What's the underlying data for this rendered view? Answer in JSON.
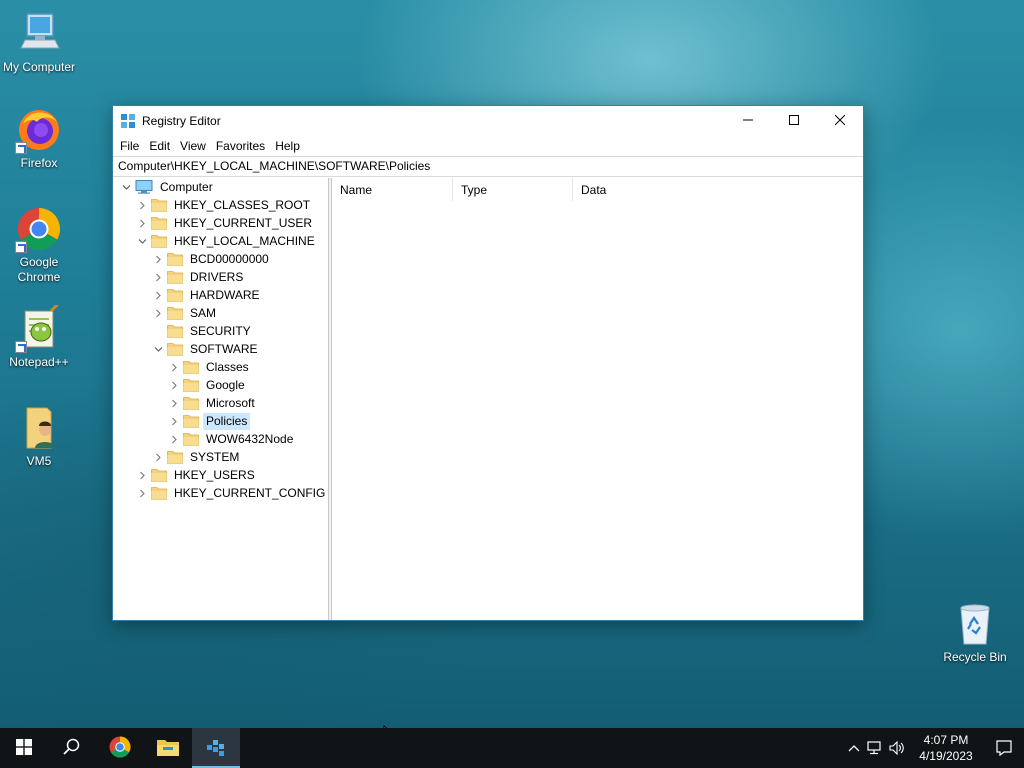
{
  "desktop": {
    "icons": [
      {
        "label": "My Computer",
        "icon": "monitor-icon"
      },
      {
        "label": "Firefox",
        "icon": "firefox-icon"
      },
      {
        "label": "Google Chrome",
        "icon": "chrome-icon"
      },
      {
        "label": "Notepad++",
        "icon": "notepadpp-icon"
      },
      {
        "label": "VM5",
        "icon": "user-folder-icon"
      },
      {
        "label": "Recycle Bin",
        "icon": "recycle-bin-icon"
      }
    ]
  },
  "window": {
    "title": "Registry Editor",
    "controls": {
      "minimize": "minimize",
      "maximize": "maximize",
      "close": "close"
    },
    "menu": [
      "File",
      "Edit",
      "View",
      "Favorites",
      "Help"
    ],
    "address": "Computer\\HKEY_LOCAL_MACHINE\\SOFTWARE\\Policies",
    "columns": [
      "Name",
      "Type",
      "Data"
    ],
    "tree": [
      {
        "label": "Computer",
        "level": 0,
        "chevron": "down",
        "icon": "computer"
      },
      {
        "label": "HKEY_CLASSES_ROOT",
        "level": 1,
        "chevron": "right"
      },
      {
        "label": "HKEY_CURRENT_USER",
        "level": 1,
        "chevron": "right"
      },
      {
        "label": "HKEY_LOCAL_MACHINE",
        "level": 1,
        "chevron": "down"
      },
      {
        "label": "BCD00000000",
        "level": 2,
        "chevron": "right"
      },
      {
        "label": "DRIVERS",
        "level": 2,
        "chevron": "right"
      },
      {
        "label": "HARDWARE",
        "level": 2,
        "chevron": "right"
      },
      {
        "label": "SAM",
        "level": 2,
        "chevron": "right"
      },
      {
        "label": "SECURITY",
        "level": 2,
        "chevron": "none"
      },
      {
        "label": "SOFTWARE",
        "level": 2,
        "chevron": "down"
      },
      {
        "label": "Classes",
        "level": 3,
        "chevron": "right"
      },
      {
        "label": "Google",
        "level": 3,
        "chevron": "right"
      },
      {
        "label": "Microsoft",
        "level": 3,
        "chevron": "right"
      },
      {
        "label": "Policies",
        "level": 3,
        "chevron": "right",
        "selected": true
      },
      {
        "label": "WOW6432Node",
        "level": 3,
        "chevron": "right"
      },
      {
        "label": "SYSTEM",
        "level": 2,
        "chevron": "right"
      },
      {
        "label": "HKEY_USERS",
        "level": 1,
        "chevron": "right"
      },
      {
        "label": "HKEY_CURRENT_CONFIG",
        "level": 1,
        "chevron": "right"
      }
    ]
  },
  "taskbar": {
    "buttons": [
      "start-icon",
      "search-icon",
      "chrome-icon",
      "file-explorer-icon",
      "registry-editor-icon"
    ],
    "active": "registry-editor-icon",
    "time": "4:07 PM",
    "date": "4/19/2023"
  },
  "colors": {
    "selection": "#cce8ff",
    "folder": "#f5d27a",
    "taskbar": "#101417",
    "accent": "#76b9ed"
  }
}
